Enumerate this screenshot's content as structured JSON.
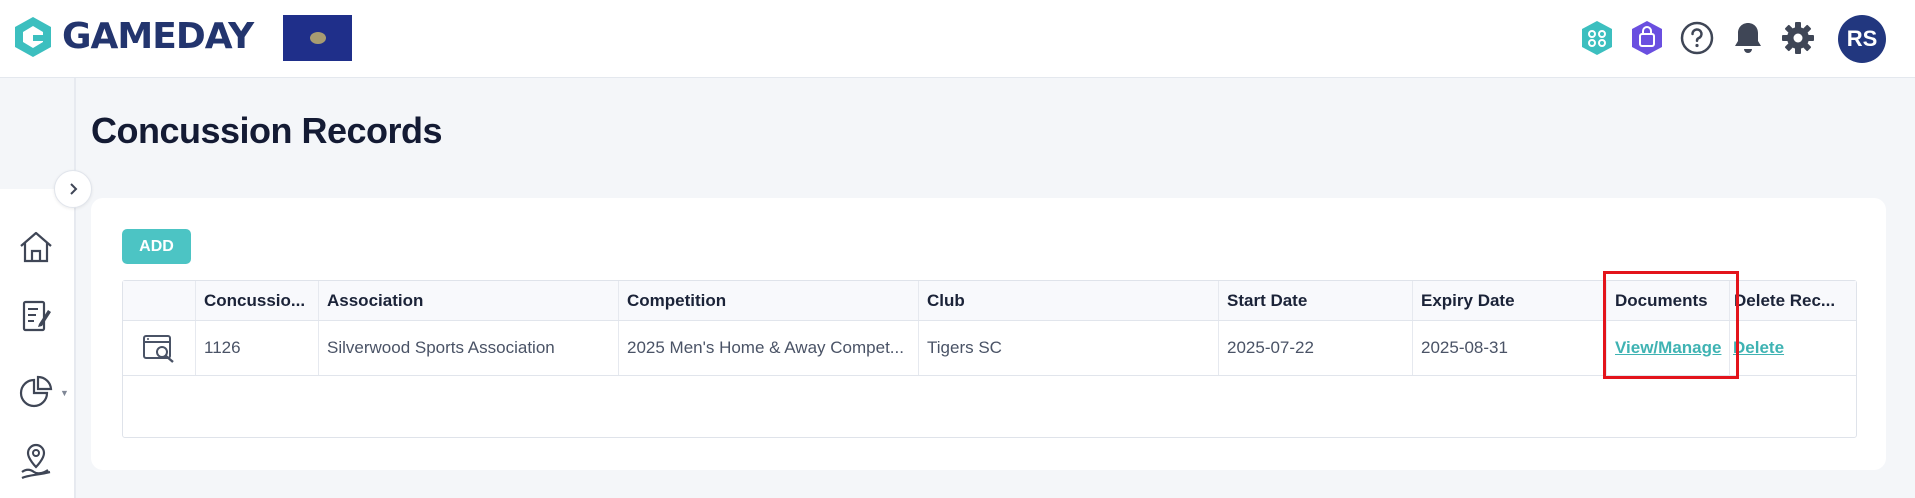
{
  "brand": {
    "name": "GAMEDAY",
    "colors": {
      "navy": "#23356e",
      "teal": "#3cbfbf",
      "purple": "#6a4fe0"
    }
  },
  "header": {
    "icons": [
      "members-icon",
      "shop-icon",
      "help-icon",
      "bell-icon",
      "gear-icon"
    ],
    "avatar_initials": "RS"
  },
  "sidebar": {
    "icons": [
      "home-icon",
      "registration-icon",
      "reports-icon",
      "location-icon"
    ]
  },
  "page": {
    "title": "Concussion Records"
  },
  "toolbar": {
    "add_label": "ADD"
  },
  "table": {
    "columns": [
      "",
      "Concussio...",
      "Association",
      "Competition",
      "Club",
      "Start Date",
      "Expiry Date",
      "Documents",
      "Delete Rec..."
    ],
    "rows": [
      {
        "id": "1126",
        "association": "Silverwood Sports Association",
        "competition": "2025 Men's Home & Away Compet...",
        "club": "Tigers SC",
        "start_date": "2025-07-22",
        "expiry_date": "2025-08-31",
        "documents_link": "View/Manage",
        "delete_link": "Delete"
      }
    ]
  }
}
